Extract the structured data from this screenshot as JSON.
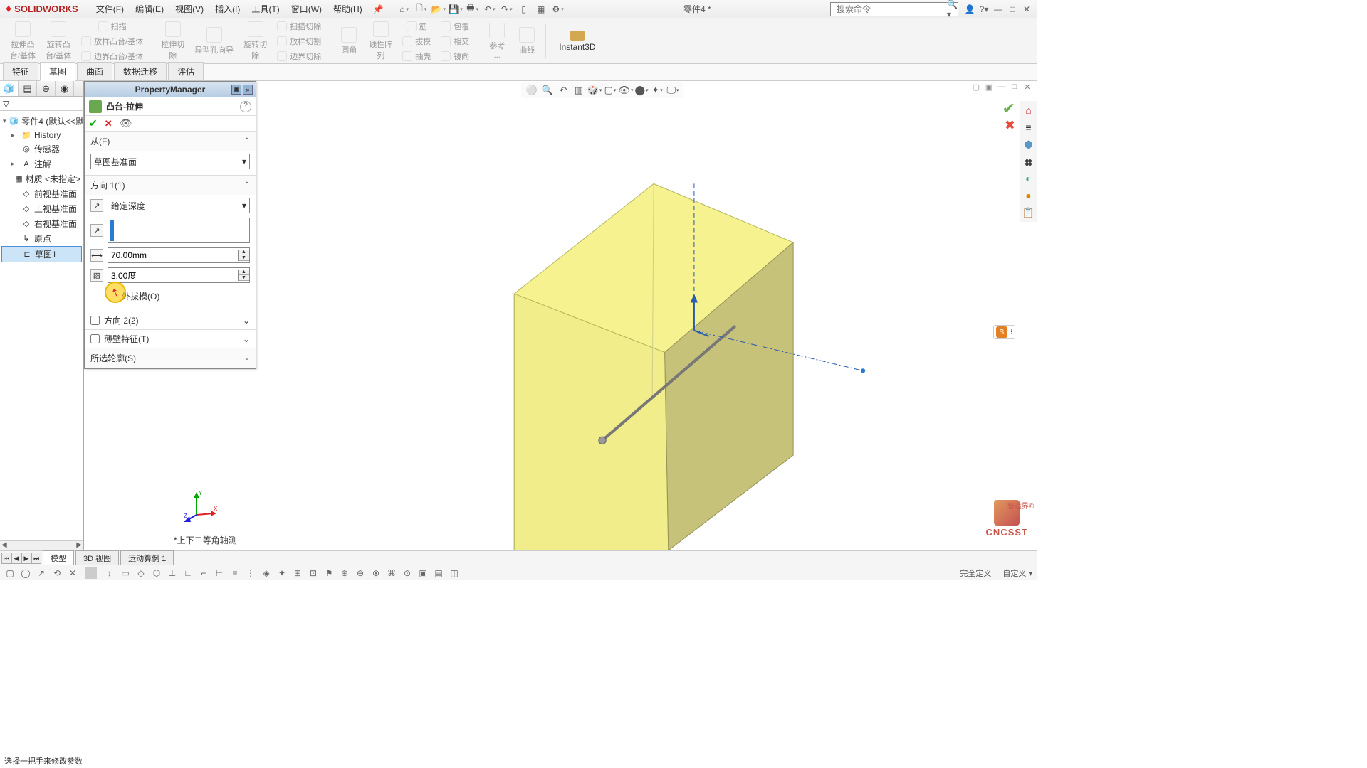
{
  "app": {
    "name": "SOLIDWORKS",
    "doc_title": "零件4 *"
  },
  "menu": [
    "文件(F)",
    "编辑(E)",
    "视图(V)",
    "插入(I)",
    "工具(T)",
    "窗口(W)",
    "帮助(H)"
  ],
  "search": {
    "placeholder": "搜索命令"
  },
  "ribbon": {
    "big": [
      {
        "l1": "拉伸凸",
        "l2": "台/基体"
      },
      {
        "l1": "旋转凸",
        "l2": "台/基体"
      }
    ],
    "col1": [
      "扫描",
      "放样凸台/基体",
      "边界凸台/基体"
    ],
    "big2": [
      {
        "l1": "拉伸切",
        "l2": "除"
      },
      {
        "l1": "异型孔向导",
        "l2": ""
      },
      {
        "l1": "旋转切",
        "l2": "除"
      }
    ],
    "col2": [
      "扫描切除",
      "放样切割",
      "边界切除"
    ],
    "big3": [
      {
        "l1": "圆角",
        "l2": ""
      },
      {
        "l1": "线性阵",
        "l2": "列"
      }
    ],
    "col3": [
      "筋",
      "拔模",
      "抽壳"
    ],
    "col3b": [
      "包覆",
      "相交",
      "镜向"
    ],
    "big4": [
      {
        "l1": "参考",
        "l2": "..."
      },
      {
        "l1": "曲线",
        "l2": ""
      }
    ],
    "instant3d": "Instant3D"
  },
  "tabs": [
    "特征",
    "草图",
    "曲面",
    "数据迁移",
    "评估"
  ],
  "left_panel": {
    "root": "零件4  (默认<<默认",
    "items": [
      {
        "icon": "▸",
        "label": "History"
      },
      {
        "icon": "",
        "label": "传感器"
      },
      {
        "icon": "▸",
        "label": "注解"
      },
      {
        "icon": "",
        "label": "材质 <未指定>"
      },
      {
        "icon": "",
        "label": "前视基准面"
      },
      {
        "icon": "",
        "label": "上视基准面"
      },
      {
        "icon": "",
        "label": "右视基准面"
      },
      {
        "icon": "",
        "label": "原点"
      },
      {
        "icon": "",
        "label": "草图1",
        "selected": true
      }
    ]
  },
  "pm": {
    "title": "PropertyManager",
    "feature": "凸台-拉伸",
    "from_label": "从(F)",
    "from_value": "草图基准面",
    "dir1_label": "方向 1(1)",
    "dir1_type": "给定深度",
    "depth": "70.00mm",
    "draft": "3.00度",
    "draft_out": "外拔模(O)",
    "dir2_label": "方向 2(2)",
    "thin_label": "薄壁特征(T)",
    "contour_label": "所选轮廓(S)"
  },
  "viewport": {
    "view_label": "*上下二等角轴测"
  },
  "bottom_tabs": [
    "模型",
    "3D 视图",
    "运动算例 1"
  ],
  "status": {
    "hint": "选择一把手来修改参数",
    "r1": "完全定义",
    "r2": "自定义  ▾"
  },
  "watermark": {
    "text": "CNCSST",
    "side": "智造界®"
  }
}
